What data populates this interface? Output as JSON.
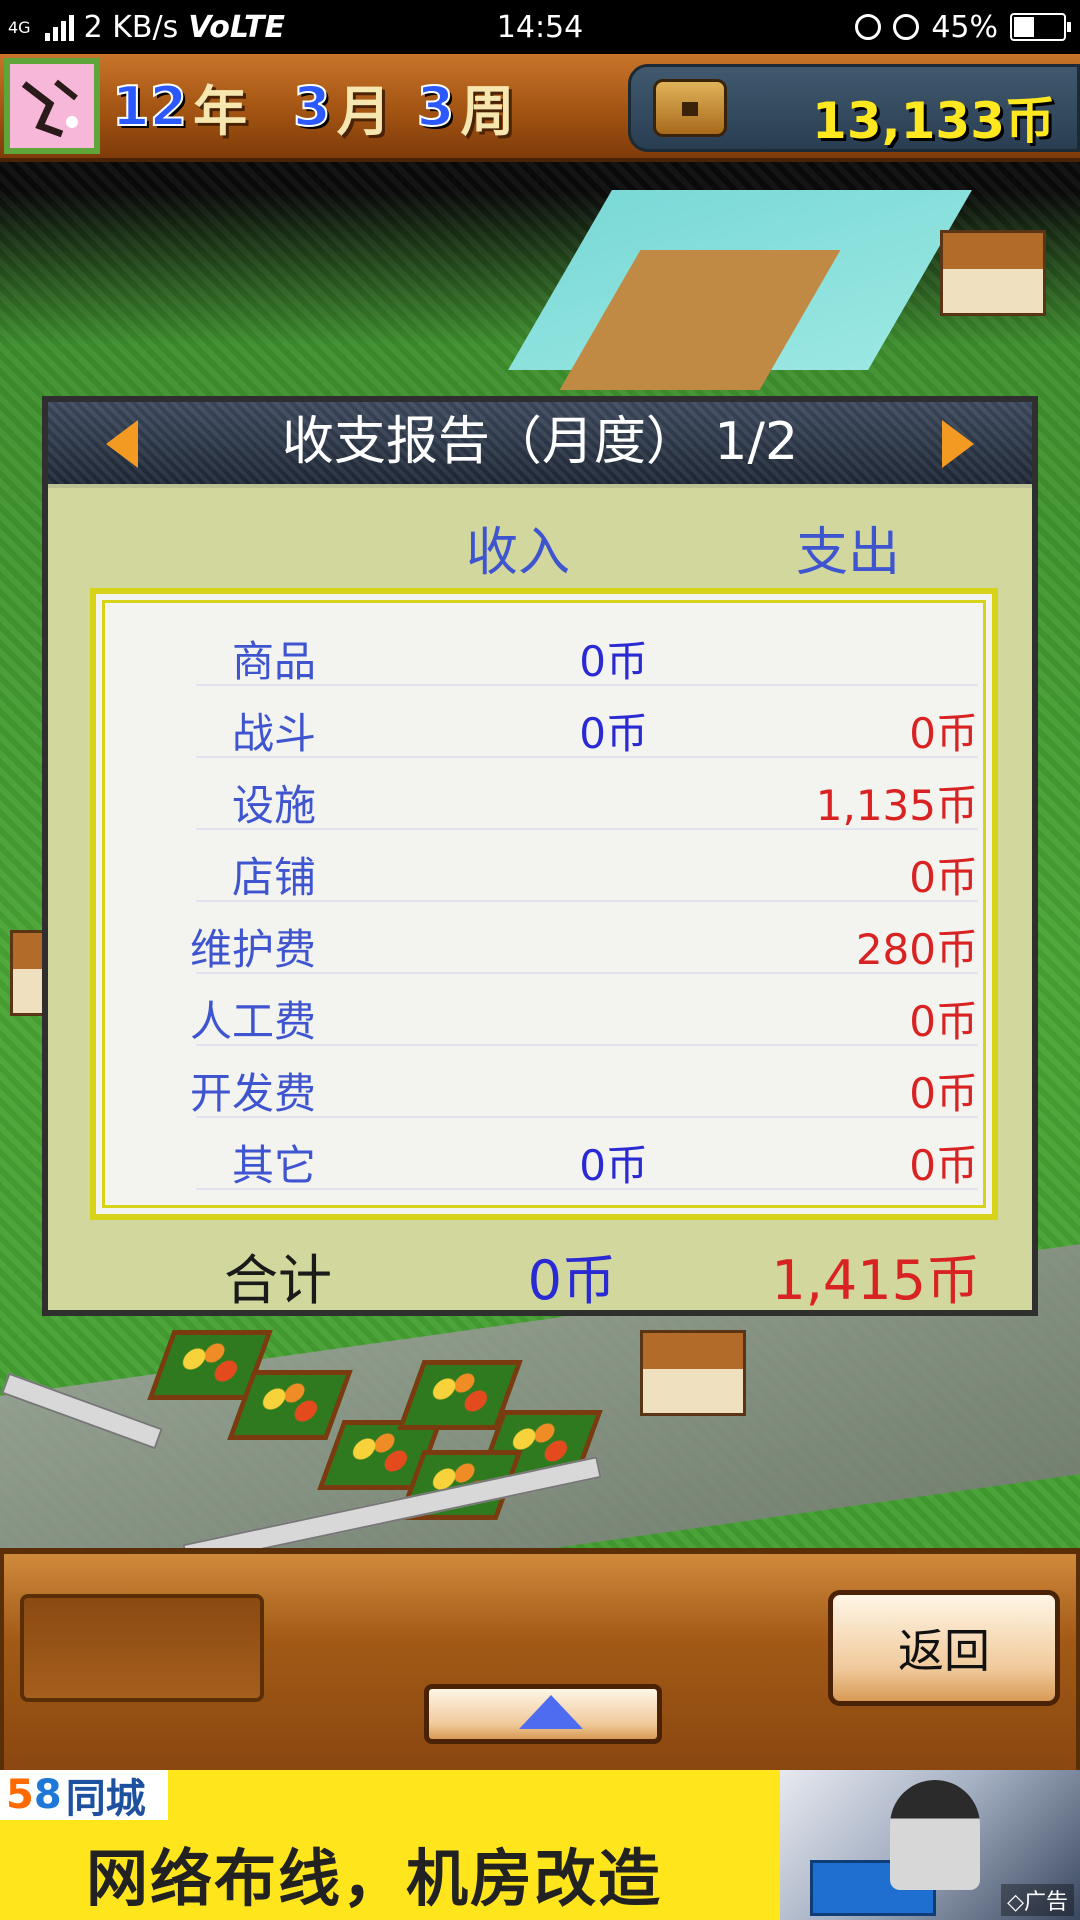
{
  "status_bar": {
    "network": "4G",
    "speed": "2 KB/s",
    "volte": "VoLTE",
    "time": "14:54",
    "battery_percent": "45%",
    "battery_level": 0.45,
    "icons": [
      "signal-icon",
      "rotation-lock-icon",
      "alarm-icon",
      "battery-icon"
    ]
  },
  "top_bar": {
    "avatar_icon": "character-portrait-icon",
    "date": {
      "year_num": "12",
      "year_unit": "年",
      "month_num": "3",
      "month_unit": "月",
      "week_num": "3",
      "week_unit": "周"
    },
    "treasury_icon": "treasure-chest-icon",
    "money": "13,133币"
  },
  "report": {
    "title": "收支报告（月度） 1/2",
    "prev_icon": "arrow-left-icon",
    "next_icon": "arrow-right-icon",
    "columns": {
      "income": "收入",
      "expense": "支出"
    },
    "rows": [
      {
        "label": "商品",
        "income": "0币",
        "expense": ""
      },
      {
        "label": "战斗",
        "income": "0币",
        "expense": "0币"
      },
      {
        "label": "设施",
        "income": "",
        "expense": "1,135币"
      },
      {
        "label": "店铺",
        "income": "",
        "expense": "0币"
      },
      {
        "label": "维护费",
        "income": "",
        "expense": "280币"
      },
      {
        "label": "人工费",
        "income": "",
        "expense": "0币"
      },
      {
        "label": "开发费",
        "income": "",
        "expense": "0币"
      },
      {
        "label": "其它",
        "income": "0币",
        "expense": "0币"
      }
    ],
    "total": {
      "label": "合计",
      "income": "0币",
      "expense": "1,415币"
    }
  },
  "bottom_panel": {
    "back_label": "返回",
    "up_icon": "triangle-up-icon"
  },
  "ad": {
    "logo_5": "5",
    "logo_8": "8",
    "logo_brand": "同城",
    "headline": "网络布线，机房改造",
    "tag": "◇广告",
    "colors": {
      "background": "#ffe51c"
    }
  },
  "colors": {
    "income_text": "#2a2ad4",
    "expense_text": "#d92222",
    "label_text": "#3f55d0",
    "dialog_bg": "#d2d89d",
    "money_text": "#ffe820"
  }
}
